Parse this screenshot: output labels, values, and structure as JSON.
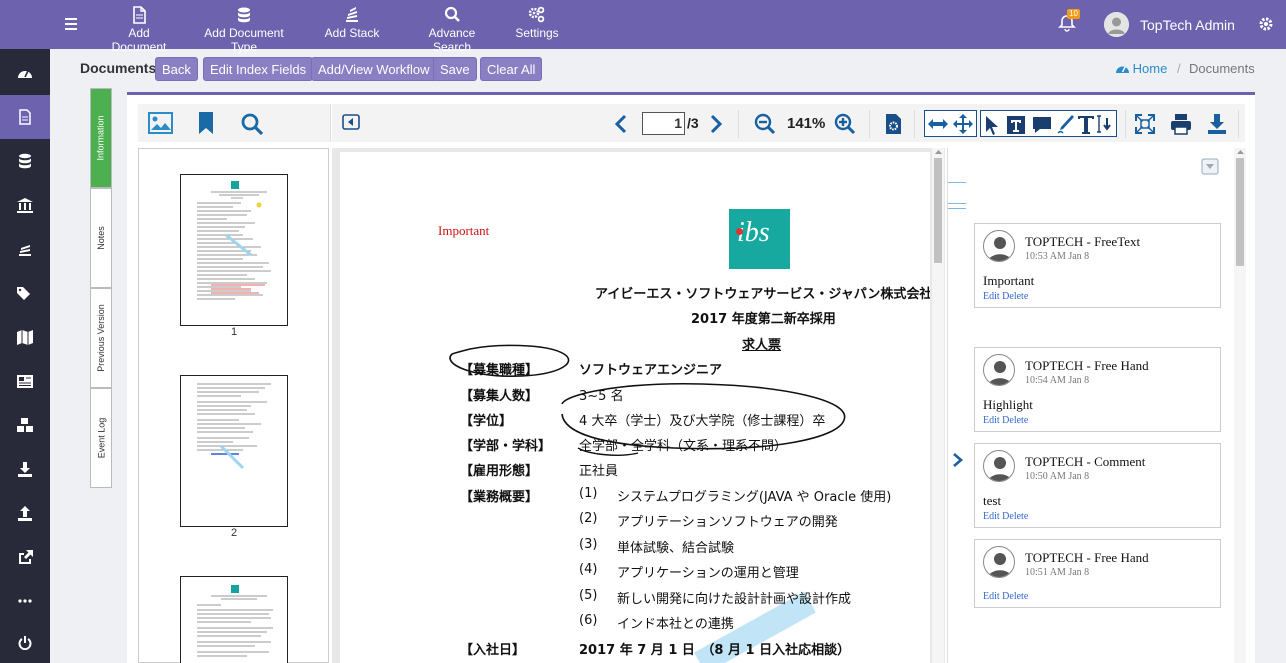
{
  "topbar": {
    "items": [
      {
        "label": "Add Document",
        "icon": "document-icon"
      },
      {
        "label": "Add Document Type",
        "icon": "database-icon"
      },
      {
        "label": "Add Stack",
        "icon": "stack-icon"
      },
      {
        "label": "Advance Search",
        "icon": "search-icon"
      },
      {
        "label": "Settings",
        "icon": "gears-icon"
      }
    ],
    "notification_count": "10",
    "user_name": "TopTech Admin",
    "brand_color": "#6c62ad"
  },
  "header": {
    "title": "Documents",
    "buttons": [
      "Back",
      "Edit Index Fields",
      "Add/View Workflow",
      "Save",
      "Clear All"
    ],
    "breadcrumb": {
      "home": "Home",
      "current": "Documents"
    }
  },
  "vtabs": [
    "Information",
    "Notes",
    "Previous Version",
    "Event Log"
  ],
  "viewer": {
    "current_page": "1",
    "total_pages": "/3",
    "zoom": "141%",
    "thumbnails": [
      "1",
      "2"
    ]
  },
  "document": {
    "stamp": "Important",
    "logo_text": "ibs",
    "company": "アイビーエス・ソフトウェアサービス・ジャパン株式会社",
    "subtitle": "2017 年度第二新卒採用",
    "heading": "求人票",
    "rows": [
      {
        "label": "【募集職種】",
        "value": "ソフトウェアエンジニア",
        "bold": true
      },
      {
        "label": "【募集人数】",
        "value": "3~5 名"
      },
      {
        "label": "【学位】",
        "value": "4 大卒（学士）及び大学院（修士課程）卒"
      },
      {
        "label": "【学部・学科】",
        "value": "全学部・全学科（文系・理系不問）"
      },
      {
        "label": "【雇用形態】",
        "value": "正社員"
      }
    ],
    "business_label": "【業務概要】",
    "business": [
      {
        "num": "(1)",
        "text": "システムプログラミング(JAVA や Oracle 使用)"
      },
      {
        "num": "(2)",
        "text": "アプリテーションソフトウェアの開発"
      },
      {
        "num": "(3)",
        "text": "単体試験、結合試験"
      },
      {
        "num": "(4)",
        "text": "アプリケーションの運用と管理"
      },
      {
        "num": "(5)",
        "text": "新しい開発に向けた設計計画や設計作成"
      },
      {
        "num": "(6)",
        "text": "インド本社との連携"
      }
    ],
    "entry_label": "【入社日】",
    "entry_value": "2017 年 7 月 1 日　（8 月 1 日入社応相談）"
  },
  "annotations": [
    {
      "title": "TOPTECH - FreeText",
      "time": "10:53 AM Jan 8",
      "text": "Important",
      "edit": "Edit",
      "delete": "Delete"
    },
    {
      "title": "TOPTECH - Free Hand",
      "time": "10:54 AM Jan 8",
      "text": "Highlight",
      "edit": "Edit",
      "delete": "Delete"
    },
    {
      "title": "TOPTECH - Comment",
      "time": "10:50 AM Jan 8",
      "text": "test",
      "edit": "Edit",
      "delete": "Delete"
    },
    {
      "title": "TOPTECH - Free Hand",
      "time": "10:51 AM Jan 8",
      "text": "",
      "edit": "Edit",
      "delete": "Delete"
    }
  ]
}
